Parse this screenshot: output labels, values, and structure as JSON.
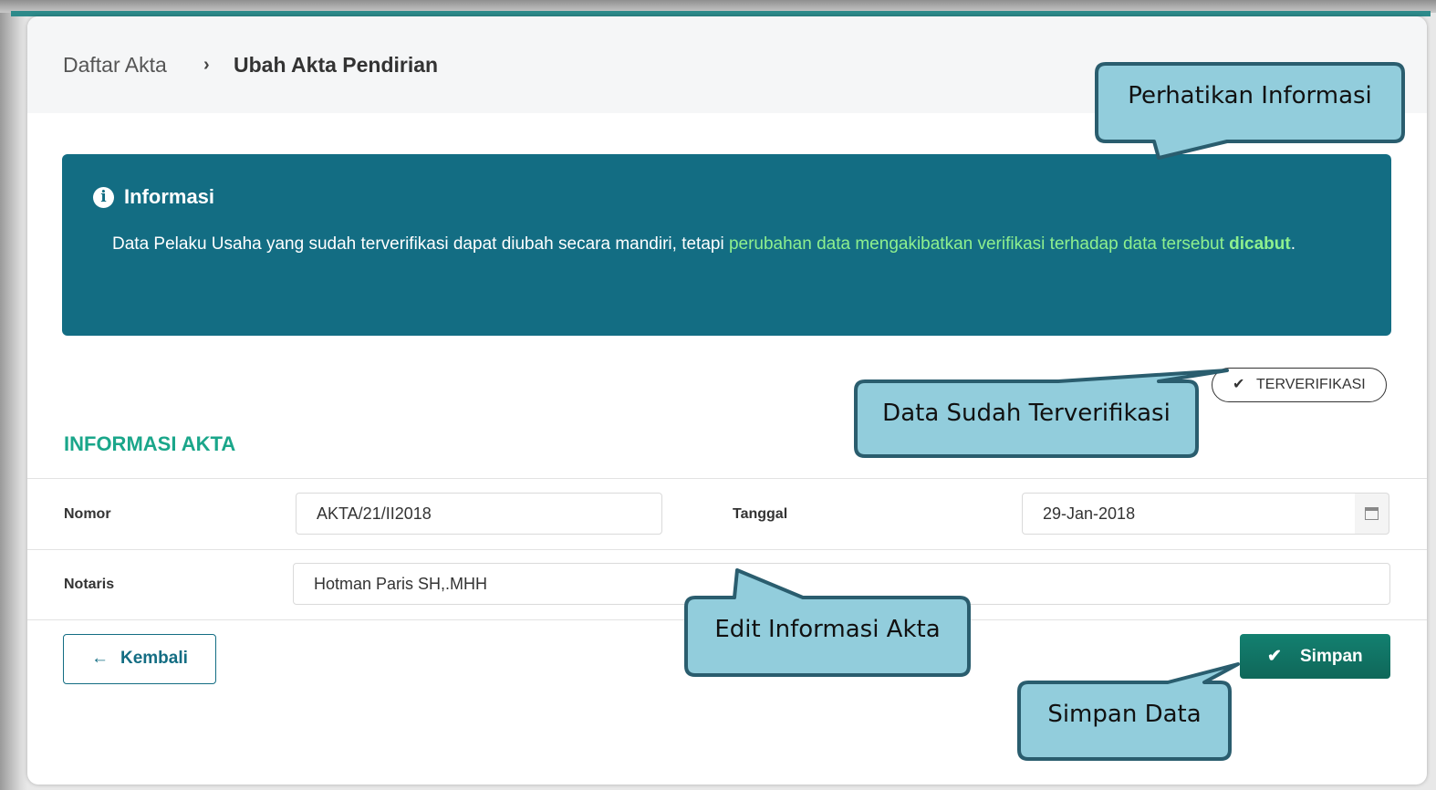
{
  "breadcrumb": {
    "parent": "Daftar Akta",
    "separator": "›",
    "current": "Ubah Akta Pendirian"
  },
  "info_box": {
    "icon": "info-circle-icon",
    "title": "Informasi",
    "text_plain": "Data Pelaku Usaha yang sudah terverifikasi dapat diubah secara mandiri, tetapi ",
    "text_highlight": "perubahan data mengakibatkan verifikasi terhadap data tersebut ",
    "text_bold": "dicabut",
    "text_end": "."
  },
  "verified_badge": {
    "icon": "check-icon",
    "label": "TERVERIFIKASI"
  },
  "section_title": "INFORMASI AKTA",
  "form": {
    "nomor": {
      "label": "Nomor",
      "value": "AKTA/21/II2018"
    },
    "tanggal": {
      "label": "Tanggal",
      "value": "29-Jan-2018",
      "icon": "calendar-icon"
    },
    "notaris": {
      "label": "Notaris",
      "value": "Hotman Paris SH,.MHH"
    }
  },
  "buttons": {
    "back": {
      "label": "Kembali",
      "icon": "arrow-left-icon"
    },
    "save": {
      "label": "Simpan",
      "icon": "check-icon"
    }
  },
  "callouts": {
    "info": "Perhatikan Informasi",
    "verified": "Data Sudah Terverifikasi",
    "edit": "Edit Informasi Akta",
    "save": "Simpan Data"
  },
  "colors": {
    "info_bg": "#136d83",
    "accent_green": "#1aa68a",
    "highlight_text": "#8ef08e",
    "callout_fill": "#92cddc",
    "callout_border": "#2a5d6e",
    "save_button": "#0f6759"
  }
}
